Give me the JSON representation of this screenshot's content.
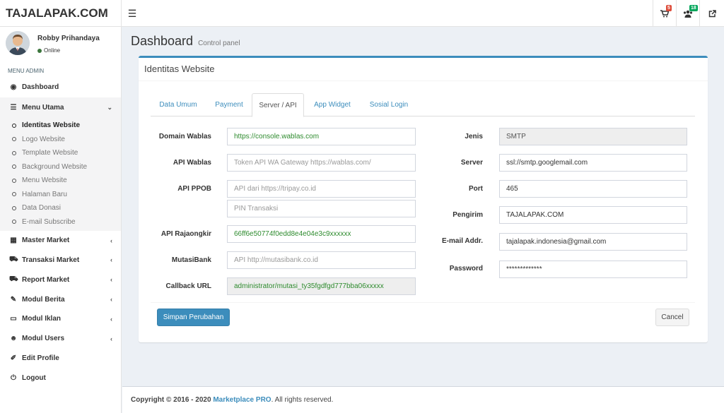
{
  "header": {
    "logo": "TAJALAPAK.COM",
    "cart_badge": "5",
    "users_badge": "18"
  },
  "user": {
    "name": "Robby Prihandaya",
    "status": "Online"
  },
  "sidebar": {
    "section": "MENU ADMIN",
    "dashboard": "Dashboard",
    "menu_utama": "Menu Utama",
    "submenu": [
      "Identitas Website",
      "Logo Website",
      "Template Website",
      "Background Website",
      "Menu Website",
      "Halaman Baru",
      "Data Donasi",
      "E-mail Subscribe"
    ],
    "items": [
      "Master Market",
      "Transaksi Market",
      "Report Market",
      "Modul Berita",
      "Modul Iklan",
      "Modul Users"
    ],
    "edit_profile": "Edit Profile",
    "logout": "Logout"
  },
  "page": {
    "title": "Dashboard",
    "subtitle": "Control panel"
  },
  "box": {
    "title": "Identitas Website",
    "tabs": [
      "Data Umum",
      "Payment",
      "Server / API",
      "App Widget",
      "Sosial Login"
    ]
  },
  "form": {
    "domain_wablas_label": "Domain Wablas",
    "domain_wablas_value": "https://console.wablas.com",
    "api_wablas_label": "API Wablas",
    "api_wablas_placeholder": "Token API WA Gateway https://wablas.com/",
    "api_ppob_label": "API PPOB",
    "api_ppob_placeholder": "API dari https://tripay.co.id",
    "pin_placeholder": "PIN Transaksi",
    "rajaongkir_label": "API Rajaongkir",
    "rajaongkir_value": "66ff6e50774f0edd8e4e04e3c9xxxxxx",
    "mutasibank_label": "MutasiBank",
    "mutasibank_placeholder": "API http://mutasibank.co.id",
    "callback_label": "Callback URL",
    "callback_value": "administrator/mutasi_ty35fgdfgd777bba06xxxxx",
    "jenis_label": "Jenis",
    "jenis_value": "SMTP",
    "server_label": "Server",
    "server_value": "ssl://smtp.googlemail.com",
    "port_label": "Port",
    "port_value": "465",
    "pengirim_label": "Pengirim",
    "pengirim_value": "TAJALAPAK.COM",
    "email_label": "E-mail Addr.",
    "email_value": "tajalapak.indonesia@gmail.com",
    "password_label": "Password",
    "password_value": "*************",
    "save_label": "Simpan Perubahan",
    "cancel_label": "Cancel"
  },
  "footer": {
    "copyright": "Copyright © 2016 - 2020",
    "brand": "Marketplace PRO",
    "rights": ". All rights reserved."
  }
}
